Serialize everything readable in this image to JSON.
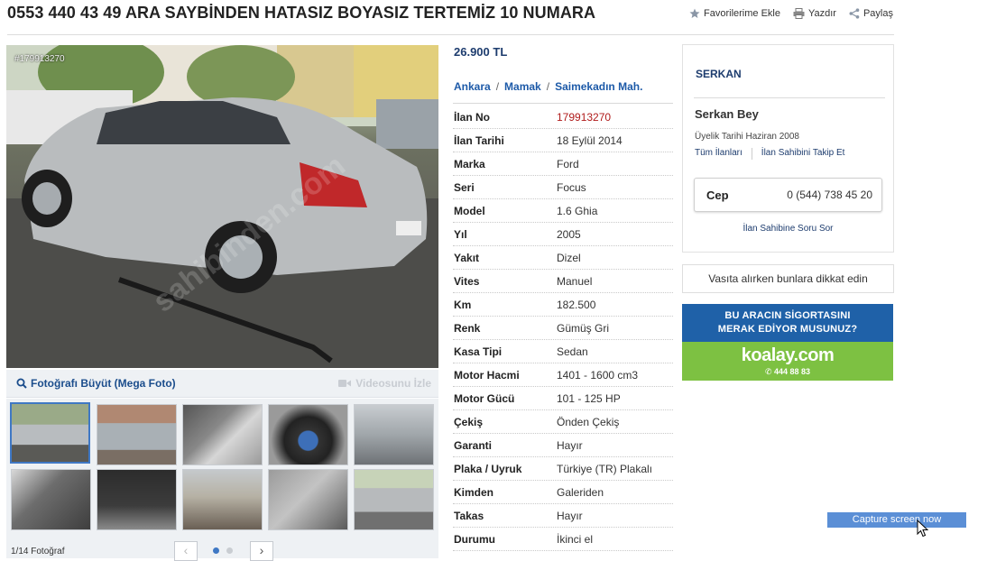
{
  "listing": {
    "title": "0553 440 43 49 ARA SAYBİNDEN HATASIZ BOYASIZ TERTEMİZ 10 NUMARA",
    "actions": {
      "favorite": "Favorilerime Ekle",
      "print": "Yazdır",
      "share": "Paylaş"
    },
    "price": "26.900 TL",
    "location": {
      "city": "Ankara",
      "district": "Mamak",
      "neighborhood": "Saimekadın Mah."
    }
  },
  "gallery": {
    "photo_id": "#179913270",
    "mega_photo": "Fotoğrafı Büyüt (Mega Foto)",
    "video": "Videosunu İzle",
    "photo_count": "1/14 Fotoğraf",
    "prev": "‹",
    "next": "›",
    "pages": 2,
    "active_page": 1,
    "thumbnails": [
      {
        "name": "thumb-1"
      },
      {
        "name": "thumb-2"
      },
      {
        "name": "thumb-3"
      },
      {
        "name": "thumb-4"
      },
      {
        "name": "thumb-5"
      },
      {
        "name": "thumb-6"
      },
      {
        "name": "thumb-7"
      },
      {
        "name": "thumb-8"
      },
      {
        "name": "thumb-9"
      },
      {
        "name": "thumb-10"
      }
    ]
  },
  "specs": [
    {
      "label": "İlan No",
      "value": "179913270",
      "highlight": true
    },
    {
      "label": "İlan Tarihi",
      "value": "18 Eylül 2014"
    },
    {
      "label": "Marka",
      "value": "Ford"
    },
    {
      "label": "Seri",
      "value": "Focus"
    },
    {
      "label": "Model",
      "value": "1.6 Ghia"
    },
    {
      "label": "Yıl",
      "value": "2005"
    },
    {
      "label": "Yakıt",
      "value": "Dizel"
    },
    {
      "label": "Vites",
      "value": "Manuel"
    },
    {
      "label": "Km",
      "value": "182.500"
    },
    {
      "label": "Renk",
      "value": "Gümüş Gri"
    },
    {
      "label": "Kasa Tipi",
      "value": "Sedan"
    },
    {
      "label": "Motor Hacmi",
      "value": "1401 - 1600 cm3"
    },
    {
      "label": "Motor Gücü",
      "value": "101 - 125 HP"
    },
    {
      "label": "Çekiş",
      "value": "Önden Çekiş"
    },
    {
      "label": "Garanti",
      "value": "Hayır"
    },
    {
      "label": "Plaka / Uyruk",
      "value": "Türkiye (TR) Plakalı"
    },
    {
      "label": "Kimden",
      "value": "Galeriden"
    },
    {
      "label": "Takas",
      "value": "Hayır"
    },
    {
      "label": "Durumu",
      "value": "İkinci el"
    }
  ],
  "seller": {
    "shop": "SERKAN",
    "name": "Serkan Bey",
    "member_since": "Üyelik Tarihi  Haziran 2008",
    "all_listings": "Tüm İlanları",
    "follow": "İlan Sahibini Takip Et",
    "phone_label": "Cep",
    "phone": "0 (544) 738 45 20",
    "ask": "İlan Sahibine Soru Sor"
  },
  "warning": "Vasıta alırken bunlara dikkat edin",
  "ad": {
    "line1": "BU ARACIN SİGORTASINI",
    "line2": "MERAK EDİYOR MUSUNUZ?",
    "brand": "koalay.com",
    "phone": "444 88 83",
    "colors": {
      "top": "#1f61a8",
      "bottom": "#7dc142"
    }
  },
  "capture_button": "Capture screen now"
}
